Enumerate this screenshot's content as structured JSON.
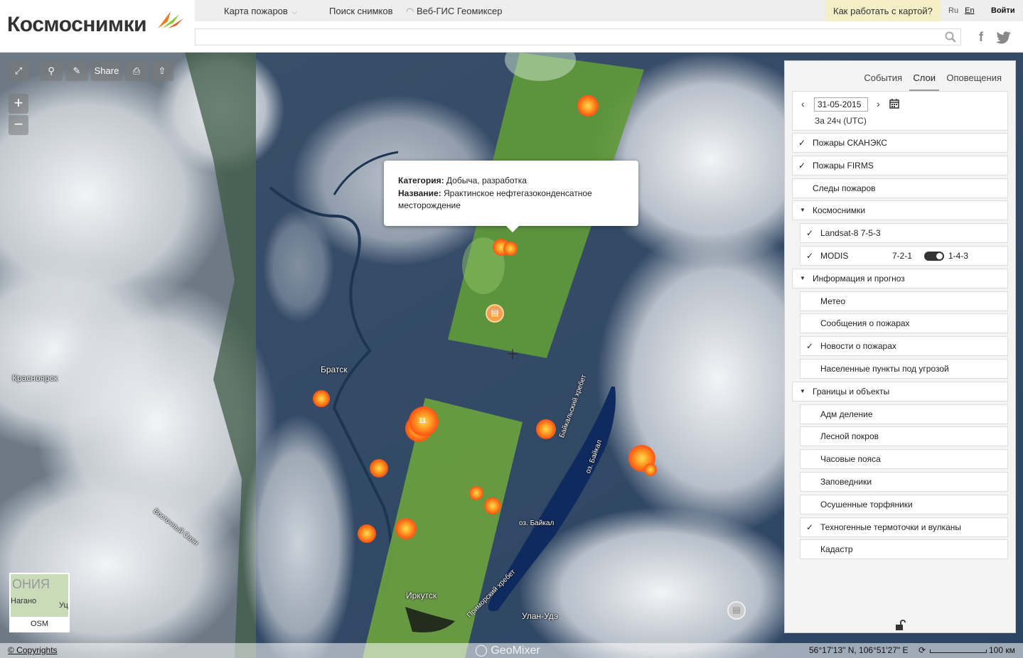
{
  "app": {
    "logo_text": "Космоснимки"
  },
  "topnav": {
    "fire_map": "Карта пожаров",
    "image_search": "Поиск снимков",
    "webgis": "Веб-ГИС Геомиксер",
    "help": "Как работать с картой?",
    "lang_ru": "Ru",
    "lang_en": "En",
    "login": "Войти"
  },
  "search": {
    "placeholder": ""
  },
  "toolbar": {
    "share_label": "Share"
  },
  "popup": {
    "category_label": "Категория:",
    "category_value": "Добыча, разработка",
    "name_label": "Название:",
    "name_value": "Ярактинское нефтегазоконденсатное месторождение"
  },
  "markers": {
    "cluster_count": "11"
  },
  "map_labels": {
    "bratsk": "Братск",
    "krasnoyarsk": "Красноярск",
    "irkutsk": "Иркутск",
    "ulan_ude": "Улан-Удэ",
    "baikal": "оз. Байкал",
    "baikal_ridge": "Байкальский хребет",
    "primorsky_ridge": "Приморский хребет",
    "east_sayan": "Восточный Саян",
    "baikal_lake_label": "оз. Байкал"
  },
  "panel": {
    "tabs": [
      "События",
      "Слои",
      "Оповещения"
    ],
    "active_tab": "Слои",
    "date": "31-05-2015",
    "date_sub": "За 24ч (UTC)",
    "layers": [
      {
        "label": "Пожары СКАНЭКС",
        "checked": "✓",
        "indent": 0
      },
      {
        "label": "Пожары FIRMS",
        "checked": "✓",
        "indent": 0
      },
      {
        "label": "Следы пожаров",
        "checked": "",
        "indent": 0
      },
      {
        "label": "Космоснимки",
        "checked": "▼",
        "indent": 0
      },
      {
        "label": "Landsat-8 7-5-3",
        "checked": "✓",
        "indent": 1
      },
      {
        "label": "MODIS",
        "checked": "✓",
        "indent": 1
      },
      {
        "label": "Информация и прогноз",
        "checked": "▼",
        "indent": 0
      },
      {
        "label": "Метео",
        "checked": "",
        "indent": 1
      },
      {
        "label": "Сообщения о пожарах",
        "checked": "",
        "indent": 1
      },
      {
        "label": "Новости о пожарах",
        "checked": "✓",
        "indent": 1
      },
      {
        "label": "Населенные пункты под угрозой",
        "checked": "",
        "indent": 1
      },
      {
        "label": "Границы и объекты",
        "checked": "▼",
        "indent": 0
      },
      {
        "label": "Адм деление",
        "checked": "",
        "indent": 1
      },
      {
        "label": "Лесной покров",
        "checked": "",
        "indent": 1
      },
      {
        "label": "Часовые пояса",
        "checked": "",
        "indent": 1
      },
      {
        "label": "Заповедники",
        "checked": "",
        "indent": 1
      },
      {
        "label": "Осушенные торфяники",
        "checked": "",
        "indent": 1
      },
      {
        "label": "Техногенные термоточки и вулканы",
        "checked": "✓",
        "indent": 1
      },
      {
        "label": "Кадастр",
        "checked": "",
        "indent": 1
      }
    ],
    "modis_left": "7-2-1",
    "modis_right": "1-4-3"
  },
  "minimap": {
    "label": "OSM",
    "place1": "Нагано",
    "place2": "Уц",
    "place3": "ОНИЯ"
  },
  "bottom": {
    "copyright": "© Copyrights",
    "coords": "56°17'13\" N, 106°51'27\" E",
    "scale": "100 км",
    "geomixer": "GeoMixer"
  },
  "colors": {
    "help_bg": "#f4efc6",
    "fire": "#ff5a14",
    "landsat": "#6fa33f"
  }
}
